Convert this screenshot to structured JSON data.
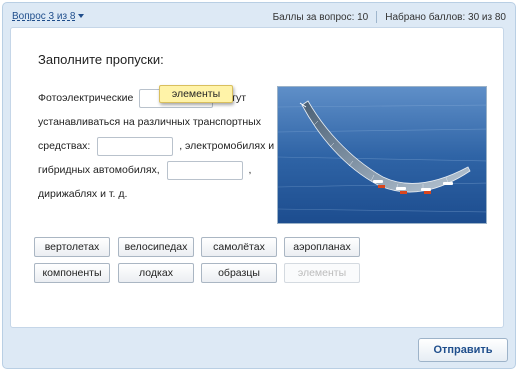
{
  "header": {
    "question_nav": "Вопрос 3 из 8",
    "points_per_question": "Баллы за вопрос: 10",
    "points_total": "Набрано баллов: 30 из 80"
  },
  "question": {
    "title": "Заполните пропуски:",
    "text_parts": [
      "Фотоэлектрические",
      "могут",
      "устанавливаться на различных транспортных",
      "средствах:",
      ", электромобилях и",
      "гибридных автомобилях,",
      ",",
      "дирижаблях и т. д."
    ],
    "dragging_word": "элементы"
  },
  "word_bank": [
    {
      "label": "вертолетах",
      "enabled": true
    },
    {
      "label": "велосипедах",
      "enabled": true
    },
    {
      "label": "самолётах",
      "enabled": true
    },
    {
      "label": "аэропланах",
      "enabled": true
    },
    {
      "label": "компоненты",
      "enabled": true
    },
    {
      "label": "лодках",
      "enabled": true
    },
    {
      "label": "образцы",
      "enabled": true
    },
    {
      "label": "элементы",
      "enabled": false
    }
  ],
  "photo": {
    "icon": "solar-aircraft-photo"
  },
  "footer": {
    "submit_label": "Отправить"
  },
  "colors": {
    "frame": "#dde9f5",
    "link": "#1f4e8c",
    "drag_highlight": "#fff3a8"
  }
}
